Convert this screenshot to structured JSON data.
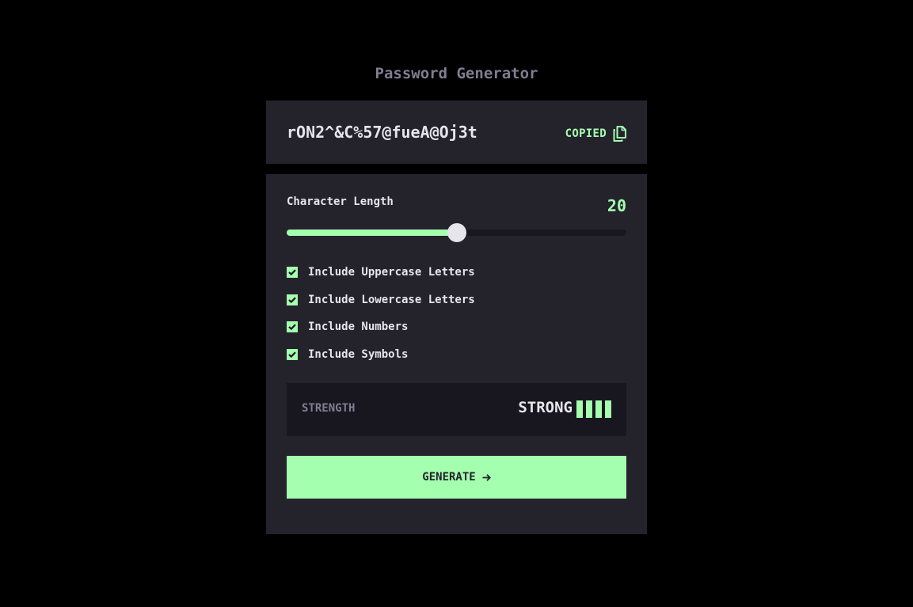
{
  "app": {
    "title": "Password Generator"
  },
  "output": {
    "password": "rON2^&C%57@fueA@Oj3t",
    "copied_label": "COPIED",
    "copy_icon": "copy-icon"
  },
  "length": {
    "label": "Character Length",
    "value": "20",
    "slider_fraction": 0.5
  },
  "options": [
    {
      "label": "Include Uppercase Letters",
      "checked": true
    },
    {
      "label": "Include Lowercase Letters",
      "checked": true
    },
    {
      "label": "Include Numbers",
      "checked": true
    },
    {
      "label": "Include Symbols",
      "checked": true
    }
  ],
  "strength": {
    "label": "STRENGTH",
    "value": "STRONG",
    "bars_filled": 4,
    "bars_total": 4
  },
  "generate": {
    "label": "GENERATE",
    "icon": "arrow-right-icon"
  },
  "colors": {
    "background": "#000000",
    "panel": "#24232c",
    "inset": "#18171f",
    "accent": "#a4ffaf",
    "text": "#e6e5ea",
    "muted": "#817d92"
  }
}
